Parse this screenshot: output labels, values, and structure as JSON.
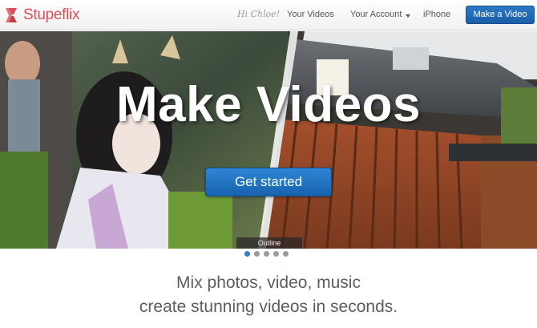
{
  "header": {
    "brand": "Stupeflix",
    "greeting": "Hi Chloe!",
    "nav": {
      "your_videos": "Your Videos",
      "your_account": "Your Account",
      "iphone": "iPhone"
    },
    "make_video_label": "Make a Video"
  },
  "hero": {
    "title": "Make Videos",
    "cta_label": "Get started",
    "caption": "Outline",
    "slides_total": 5,
    "active_slide": 1
  },
  "tagline": {
    "line1": "Mix photos, video, music",
    "line2": "create stunning videos in seconds."
  },
  "colors": {
    "brand": "#d9505a",
    "primary_button": "#1f6bb5",
    "active_dot": "#2a7fd4"
  }
}
